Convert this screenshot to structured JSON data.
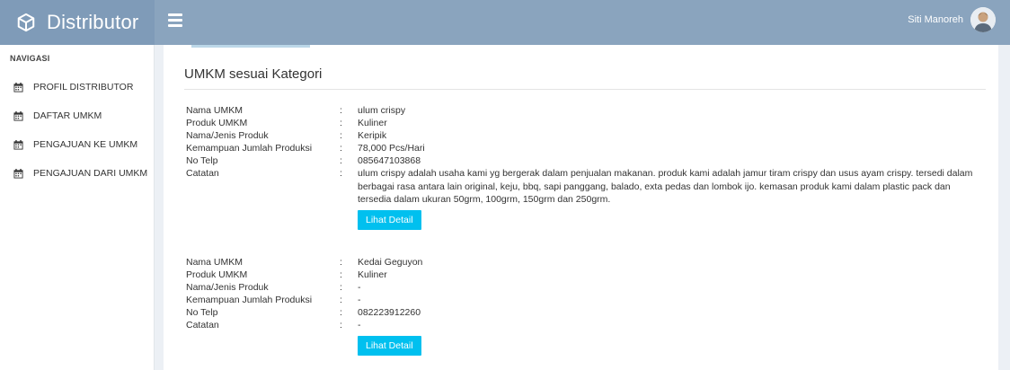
{
  "brand": {
    "name": "Distributor",
    "icon": "cube-icon"
  },
  "header": {
    "user_name": "Siti Manoreh"
  },
  "sidebar": {
    "heading": "NAVIGASI",
    "items": [
      {
        "label": "PROFIL DISTRIBUTOR",
        "icon": "calendar-icon"
      },
      {
        "label": "DAFTAR UMKM",
        "icon": "calendar-icon"
      },
      {
        "label": "PENGAJUAN KE UMKM",
        "icon": "calendar-icon"
      },
      {
        "label": "PENGAJUAN DARI UMKM",
        "icon": "calendar-icon"
      }
    ]
  },
  "main": {
    "title": "UMKM sesuai Kategori",
    "labels": {
      "nama": "Nama UMKM",
      "produk": "Produk UMKM",
      "jenis": "Nama/Jenis Produk",
      "kemampuan": "Kemampuan Jumlah Produksi",
      "telp": "No Telp",
      "catatan": "Catatan",
      "separator": ":"
    },
    "detail_button": "Lihat Detail",
    "entries": [
      {
        "nama": "ulum crispy",
        "produk": "Kuliner",
        "jenis": "Keripik",
        "kemampuan": "78,000 Pcs/Hari",
        "telp": "085647103868",
        "catatan": "ulum crispy adalah usaha kami yg bergerak dalam penjualan makanan. produk kami adalah jamur tiram crispy dan usus ayam crispy. tersedi dalam berbagai rasa antara lain original, keju, bbq, sapi panggang, balado, exta pedas dan lombok ijo. kemasan produk kami dalam plastic pack dan tersedia dalam ukuran 50grm, 100grm, 150grm dan 250grm."
      },
      {
        "nama": "Kedai Geguyon",
        "produk": "Kuliner",
        "jenis": "-",
        "kemampuan": "-",
        "telp": "082223912260",
        "catatan": "-"
      }
    ]
  },
  "colors": {
    "topbar": "#8aa4be",
    "brand_bg": "#7f9bb8",
    "button": "#00c0ef"
  }
}
